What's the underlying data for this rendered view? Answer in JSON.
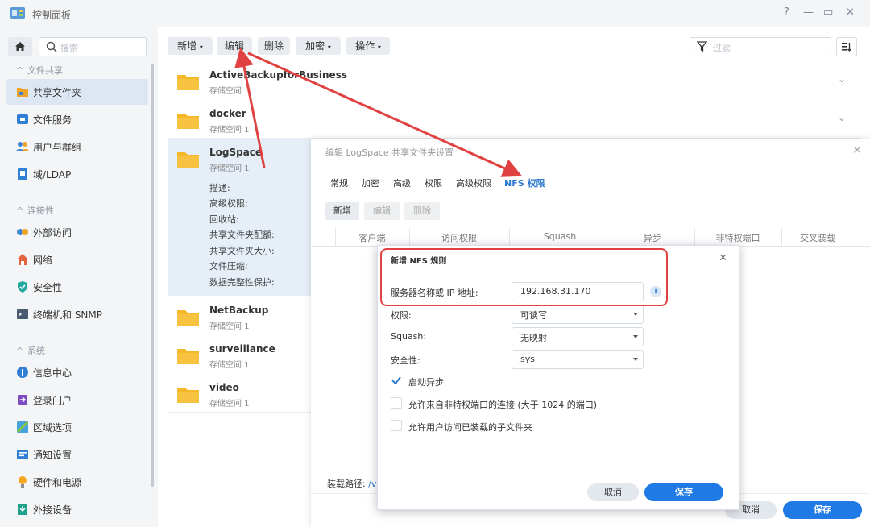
{
  "app": {
    "title": "控制面板"
  },
  "sidebar": {
    "search_placeholder": "搜索",
    "sections": [
      {
        "title": "文件共享",
        "items": [
          {
            "label": "共享文件夹",
            "active": true
          },
          {
            "label": "文件服务"
          },
          {
            "label": "用户与群组"
          },
          {
            "label": "域/LDAP"
          }
        ]
      },
      {
        "title": "连接性",
        "items": [
          {
            "label": "外部访问"
          },
          {
            "label": "网络"
          },
          {
            "label": "安全性"
          },
          {
            "label": "终端机和 SNMP"
          }
        ]
      },
      {
        "title": "系统",
        "items": [
          {
            "label": "信息中心"
          },
          {
            "label": "登录门户"
          },
          {
            "label": "区域选项"
          },
          {
            "label": "通知设置"
          },
          {
            "label": "硬件和电源"
          },
          {
            "label": "外接设备"
          }
        ]
      }
    ]
  },
  "toolbar": {
    "new_label": "新增",
    "edit_label": "编辑",
    "delete_label": "删除",
    "encrypt_label": "加密",
    "action_label": "操作",
    "filter_placeholder": "过滤"
  },
  "shares": [
    {
      "name": "ActiveBackupforBusiness",
      "sub": "存储空间"
    },
    {
      "name": "docker",
      "sub": "存储空间 1"
    },
    {
      "name": "LogSpace",
      "sub": "存储空间 1"
    },
    {
      "name": "NetBackup",
      "sub": "存储空间 1"
    },
    {
      "name": "surveillance",
      "sub": "存储空间 1"
    },
    {
      "name": "video",
      "sub": "存储空间 1"
    }
  ],
  "logspace_props": [
    "描述:",
    "高级权限:",
    "回收站:",
    "共享文件夹配额:",
    "共享文件夹大小:",
    "文件压缩:",
    "数据完整性保护:"
  ],
  "edit_dialog": {
    "title": "编辑 LogSpace 共享文件夹设置",
    "tabs": [
      "常规",
      "加密",
      "高级",
      "权限",
      "高级权限",
      "NFS 权限"
    ],
    "buttons": {
      "add": "新增",
      "edit": "编辑",
      "delete": "删除"
    },
    "columns": [
      "客户端",
      "访问权限",
      "Squash",
      "异步",
      "非特权端口",
      "交叉装载"
    ],
    "mount_label": "装载路径:",
    "mount_value": "/v",
    "cancel": "取消",
    "save": "保存"
  },
  "nfs_dialog": {
    "title": "新增 NFS 规则",
    "host_label": "服务器名称或 IP 地址:",
    "host_value": "192.168.31.170",
    "perm_label": "权限:",
    "perm_value": "可读写",
    "squash_label": "Squash:",
    "squash_value": "无映射",
    "security_label": "安全性:",
    "security_value": "sys",
    "opt_async": "启动异步",
    "opt_nonpriv": "允许来自非特权端口的连接 (大于 1024 的端口)",
    "opt_subfolder": "允许用户访问已装载的子文件夹",
    "cancel": "取消",
    "save": "保存"
  },
  "colors": {
    "accent": "#2b78d0",
    "primary_button": "#1f7ae6",
    "highlight": "#e04141",
    "folder": "#f5b829"
  }
}
